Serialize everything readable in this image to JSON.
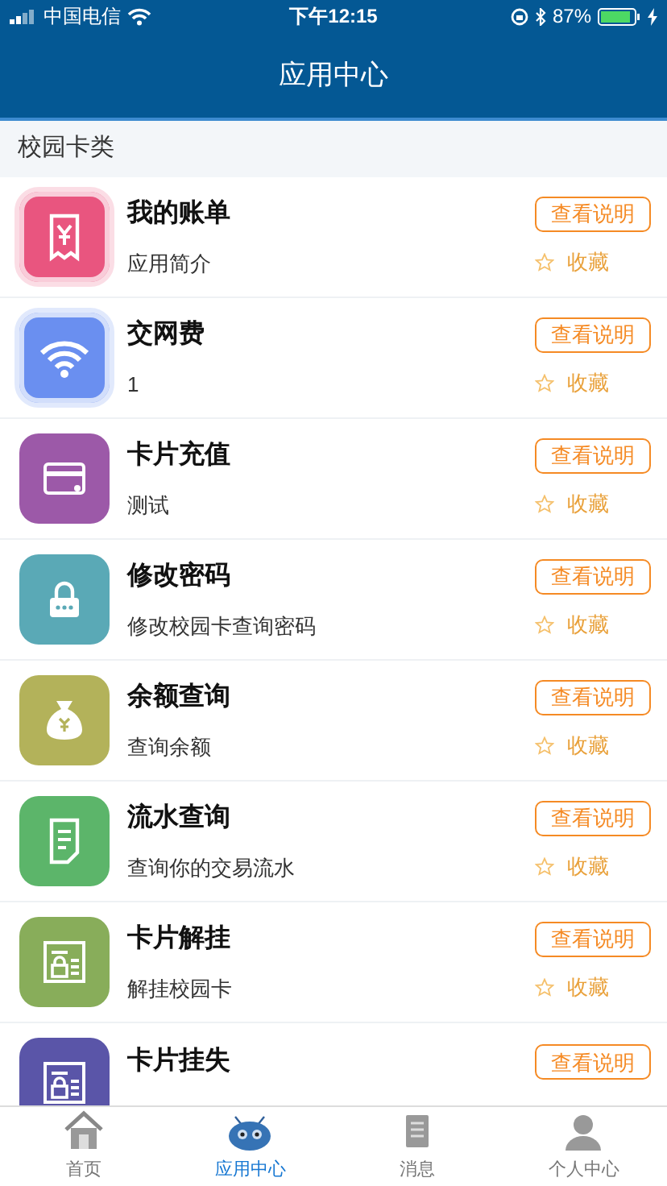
{
  "status_bar": {
    "carrier": "中国电信",
    "time": "下午12:15",
    "battery": "87%"
  },
  "nav": {
    "title": "应用中心"
  },
  "section": {
    "title": "校园卡类"
  },
  "apps": [
    {
      "title": "我的账单",
      "subtitle": "应用简介",
      "button": "查看说明",
      "favorite": "收藏",
      "favorited": false,
      "color": "#e9557f",
      "kind": "receipt",
      "ringed": true
    },
    {
      "title": "交网费",
      "subtitle": "1",
      "button": "查看说明",
      "favorite": "收藏",
      "favorited": false,
      "color": "#6a8ff0",
      "kind": "wifi",
      "ringed": true
    },
    {
      "title": "卡片充值",
      "subtitle": "测试",
      "button": "查看说明",
      "favorite": "收藏",
      "favorited": false,
      "color": "#9c59a8",
      "kind": "card",
      "ringed": false
    },
    {
      "title": "修改密码",
      "subtitle": "修改校园卡查询密码",
      "button": "查看说明",
      "favorite": "收藏",
      "favorited": false,
      "color": "#5aa9b6",
      "kind": "lock",
      "ringed": false
    },
    {
      "title": "余额查询",
      "subtitle": "查询余额",
      "button": "查看说明",
      "favorite": "收藏",
      "favorited": false,
      "color": "#b3b25a",
      "kind": "bag",
      "ringed": false
    },
    {
      "title": "流水查询",
      "subtitle": "查询你的交易流水",
      "button": "查看说明",
      "favorite": "收藏",
      "favorited": false,
      "color": "#5cb56a",
      "kind": "doc",
      "ringed": false
    },
    {
      "title": "卡片解挂",
      "subtitle": "解挂校园卡",
      "button": "查看说明",
      "favorite": "收藏",
      "favorited": false,
      "color": "#88ad5a",
      "kind": "cardlock",
      "ringed": false
    },
    {
      "title": "卡片挂失",
      "button": "查看说明",
      "color": "#5a55a8",
      "kind": "cardlock",
      "ringed": false
    }
  ],
  "tabs": [
    {
      "label": "首页",
      "kind": "home",
      "selected": false
    },
    {
      "label": "应用中心",
      "kind": "robot",
      "selected": true
    },
    {
      "label": "消息",
      "kind": "doc",
      "selected": false
    },
    {
      "label": "个人中心",
      "kind": "person",
      "selected": false
    }
  ]
}
